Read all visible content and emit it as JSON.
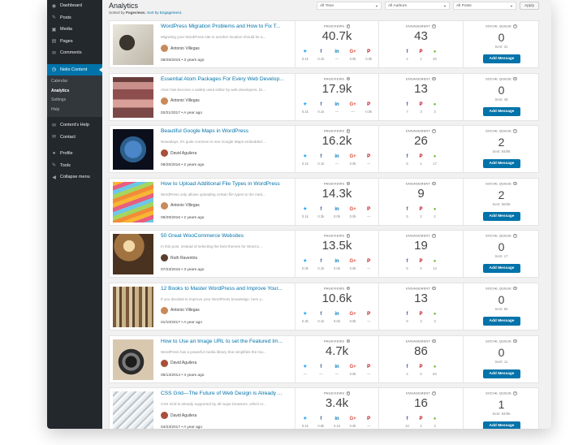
{
  "sidebar": {
    "items": [
      {
        "label": "Dashboard",
        "icon": "dashboard-icon",
        "glyph": "◉"
      },
      {
        "label": "Posts",
        "icon": "pin-icon",
        "glyph": "✎"
      },
      {
        "label": "Media",
        "icon": "media-icon",
        "glyph": "▣"
      },
      {
        "label": "Pages",
        "icon": "pages-icon",
        "glyph": "▤"
      },
      {
        "label": "Comments",
        "icon": "comments-icon",
        "glyph": "✉"
      }
    ],
    "active": {
      "label": "Nelio Content",
      "icon": "nelio-content-icon",
      "glyph": "◷"
    },
    "subitems": [
      "Calendar",
      "Analytics",
      "Settings",
      "Help"
    ],
    "lower_items": [
      {
        "label": "Content's Help",
        "icon": "help-icon",
        "glyph": "✉"
      },
      {
        "label": "Contact",
        "icon": "contact-icon",
        "glyph": "✉"
      }
    ],
    "bottom_items": [
      {
        "label": "Profile",
        "icon": "profile-icon",
        "glyph": "●"
      },
      {
        "label": "Tools",
        "icon": "tools-icon",
        "glyph": "✎"
      },
      {
        "label": "Collapse menu",
        "icon": "collapse-icon",
        "glyph": "◀"
      }
    ]
  },
  "header": {
    "title": "Analytics",
    "sorted_prefix": "Sorted by",
    "sorted_value": "Pageviews.",
    "sort_link": "Sort by Engagement."
  },
  "filters": {
    "time": "All Time",
    "authors": "All Authors",
    "posts": "All Posts",
    "apply": "Apply"
  },
  "labels": {
    "pageviews": "PAGEVIEWS",
    "engagement": "ENGAGEMENT",
    "social_queue": "SOCIAL QUEUE",
    "add_message": "Add Message"
  },
  "posts": [
    {
      "title": "WordPress Migration Problems and How to Fix T...",
      "excerpt": "Migrating your WordPress site to another location should be a...",
      "author": "Antonio Villegas",
      "date": "08/26/2015 • 3 years ago",
      "pageviews": "40.7k",
      "pv_social": [
        "0.1k",
        "0.1k",
        "—",
        "0.0k",
        "0.0k"
      ],
      "engagement": "43",
      "eng_social": [
        "2",
        "1",
        "40"
      ],
      "queue": "0",
      "sent": "Sent: 31"
    },
    {
      "title": "Essential Atom Packages For Every Web Develop...",
      "excerpt": "Atom has become a widely used editor by web developers. Di...",
      "author": "Antonio Villegas",
      "date": "02/21/2017 • A year ago",
      "pageviews": "17.9k",
      "pv_social": [
        "0.1k",
        "0.1k",
        "—",
        "—",
        "0.0k"
      ],
      "engagement": "13",
      "eng_social": [
        "7",
        "3",
        "3"
      ],
      "queue": "0",
      "sent": "Sent: 48"
    },
    {
      "title": "Beautiful Google Maps in WordPress",
      "excerpt": "Nowadays, it's quite common to see Google Maps embedded ...",
      "author": "David Aguilera",
      "date": "08/25/2016 • 2 years ago",
      "pageviews": "16.2k",
      "pv_social": [
        "0.1k",
        "0.1k",
        "—",
        "0.0k",
        "—"
      ],
      "engagement": "26",
      "eng_social": [
        "8",
        "1",
        "17"
      ],
      "queue": "2",
      "sent": "Sent: 84/86"
    },
    {
      "title": "How to Upload Additional File Types in WordPress",
      "excerpt": "WordPress only allows uploading certain file types to the med...",
      "author": "Antonio Villegas",
      "date": "09/29/2016 • 2 years ago",
      "pageviews": "14.3k",
      "pv_social": [
        "0.1k",
        "0.3k",
        "0.0k",
        "0.0k",
        "—"
      ],
      "engagement": "9",
      "eng_social": [
        "5",
        "2",
        "2"
      ],
      "queue": "2",
      "sent": "Sent: 56/58"
    },
    {
      "title": "50 Great WooCommerce Websites",
      "excerpt": "In this post, instead of selecting the best themes for WooCo...",
      "author": "Ruth Raventós",
      "date": "07/23/2015 • 3 years ago",
      "pageviews": "13.5k",
      "pv_social": [
        "0.0k",
        "0.1k",
        "0.0k",
        "0.0k",
        "—"
      ],
      "engagement": "19",
      "eng_social": [
        "5",
        "0",
        "14"
      ],
      "queue": "0",
      "sent": "Sent: 17"
    },
    {
      "title": "12 Books to Master WordPress and Improve Your...",
      "excerpt": "If you decided to improve your WordPress knowledge, here y...",
      "author": "Antonio Villegas",
      "date": "01/10/2017 • A year ago",
      "pageviews": "10.6k",
      "pv_social": [
        "0.3k",
        "0.1k",
        "0.0k",
        "0.0k",
        "—"
      ],
      "engagement": "13",
      "eng_social": [
        "9",
        "3",
        "3"
      ],
      "queue": "0",
      "sent": "Sent: 56"
    },
    {
      "title": "How to Use an Image URL to set the Featured Im...",
      "excerpt": "WordPress has a powerful media library that simplifies the ma...",
      "author": "David Aguilera",
      "date": "05/13/2014 • 4 years ago",
      "pageviews": "4.7k",
      "pv_social": [
        "—",
        "—",
        "—",
        "0.0k",
        "—"
      ],
      "engagement": "86",
      "eng_social": [
        "2",
        "0",
        "84"
      ],
      "queue": "0",
      "sent": "Sent: 11"
    },
    {
      "title": "CSS Grid—The Future of Web Design is Already ...",
      "excerpt": "CSS Grid is already supported by all major browsers, which m...",
      "author": "David Aguilera",
      "date": "04/23/2017 • A year ago",
      "pageviews": "3.4k",
      "pv_social": [
        "0.1k",
        "0.8k",
        "0.1k",
        "0.0k",
        "—"
      ],
      "engagement": "16",
      "eng_social": [
        "10",
        "3",
        "3"
      ],
      "queue": "1",
      "sent": "Sent: 94/95"
    }
  ]
}
